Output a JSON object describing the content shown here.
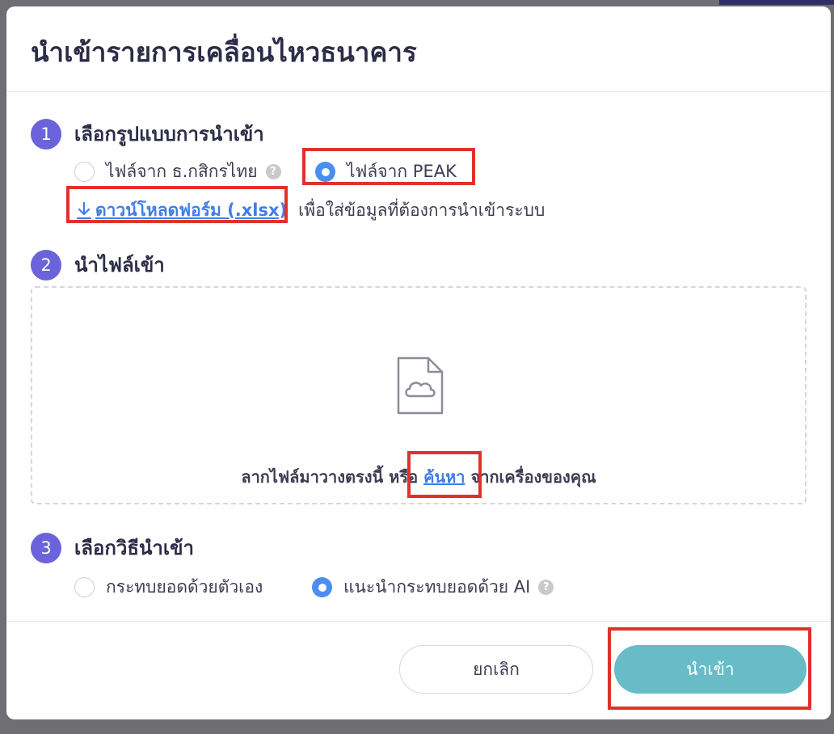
{
  "dialog": {
    "title": "นำเข้ารายการเคลื่อนไหวธนาคาร"
  },
  "step1": {
    "number": "1",
    "label": "เลือกรูปแบบการนำเข้า",
    "options": [
      {
        "label": "ไฟล์จาก ธ.กสิกรไทย",
        "selected": false,
        "help": "?"
      },
      {
        "label": "ไฟล์จาก PEAK",
        "selected": true
      }
    ],
    "download_link": "ดาวน์โหลดฟอร์ม (.xlsx)",
    "download_desc": "เพื่อใส่ข้อมูลที่ต้องการนำเข้าระบบ"
  },
  "step2": {
    "number": "2",
    "label": "นำไฟล์เข้า",
    "drop_text_before": "ลากไฟล์มาวางตรงนี้ หรือ ",
    "drop_link": "ค้นหา",
    "drop_text_after": " จากเครื่องของคุณ"
  },
  "step3": {
    "number": "3",
    "label": "เลือกวิธีนำเข้า",
    "options": [
      {
        "label": "กระทบยอดด้วยตัวเอง",
        "selected": false
      },
      {
        "label": "แนะนำกระทบยอดด้วย AI",
        "selected": true,
        "help": "?"
      }
    ]
  },
  "footer": {
    "cancel_label": "ยกเลิก",
    "import_label": "นำเข้า"
  },
  "colors": {
    "accent_step": "#6b63d9",
    "radio_selected": "#4a8ef0",
    "link": "#3f7ee8",
    "primary_button": "#67bcc7",
    "highlight": "#e0312b"
  }
}
